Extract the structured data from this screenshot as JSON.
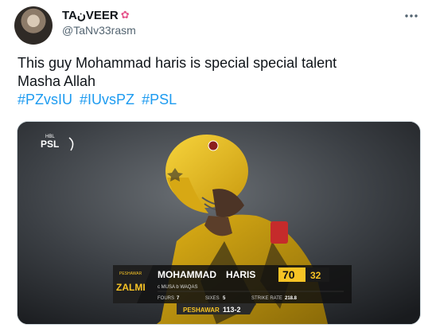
{
  "tweet": {
    "display_name": "TAنVEER",
    "handle": "@TaNv33rasm",
    "text_line1": "This guy Mohammad haris is special special talent",
    "text_line2": "Masha Allah",
    "hashtags": [
      "#PZvsIU",
      "#IUvsPZ",
      "#PSL"
    ]
  },
  "scorecard": {
    "league_tag": "HBL",
    "league_name": "PSL",
    "team_badge_small": "PESHAWAR",
    "team_badge_large": "ZALMI",
    "first_name": "MOHAMMAD",
    "last_name": "HARIS",
    "runs": "70",
    "balls": "32",
    "dismissal": "c MUSA  b WAQAS",
    "fours_label": "FOURS",
    "fours_value": "7",
    "sixes_label": "SIXES",
    "sixes_value": "5",
    "sr_label": "STRIKE RATE",
    "sr_value": "218.8",
    "team_label": "PESHAWAR",
    "team_score": "113-2"
  },
  "icons": {
    "more": "more-horizontal-icon",
    "flower": "flower-icon"
  },
  "colors": {
    "hashtag": "#1d9bf0",
    "helmet_yellow": "#f2c21a",
    "score_yellow": "#f6c325"
  }
}
